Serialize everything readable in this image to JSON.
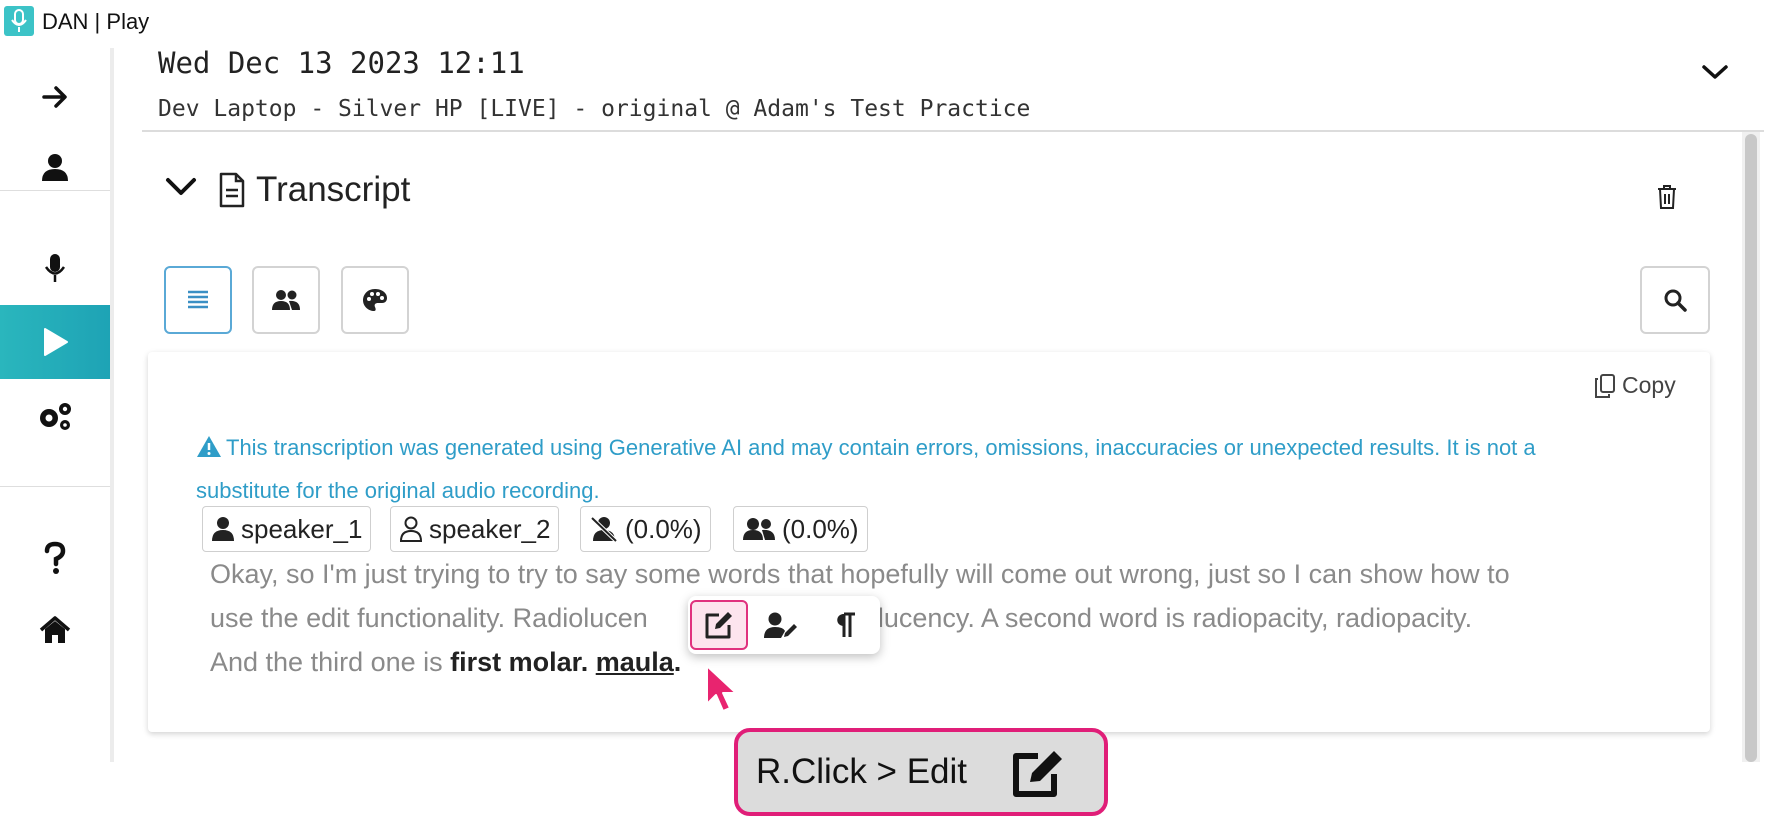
{
  "window": {
    "title": "DAN | Play"
  },
  "sidebar": {
    "items": [
      {
        "icon": "arrow-right-icon"
      },
      {
        "icon": "user-icon"
      },
      {
        "icon": "microphone-icon"
      },
      {
        "icon": "play-icon",
        "active": true
      },
      {
        "icon": "gears-icon"
      },
      {
        "icon": "question-icon"
      },
      {
        "icon": "home-icon"
      }
    ]
  },
  "header": {
    "date": "Wed Dec 13 2023 12:11",
    "subtitle": "Dev Laptop - Silver HP [LIVE] - original @ Adam's Test Practice"
  },
  "transcript": {
    "title": "Transcript",
    "copy_label": "Copy",
    "warning": "This transcription was generated using Generative AI and may contain errors, omissions, inaccuracies or unexpected results. It is not a substitute for the original audio recording.",
    "chips": [
      {
        "icon": "user-solid-icon",
        "label": "speaker_1"
      },
      {
        "icon": "user-outline-icon",
        "label": "speaker_2"
      },
      {
        "icon": "user-slash-icon",
        "label": "(0.0%)"
      },
      {
        "icon": "users-icon",
        "label": "(0.0%)"
      }
    ],
    "text": {
      "line1": "Okay, so I'm just trying to try to say some words that hopefully will come out wrong, just so I can show how to",
      "line2_a": "use the edit functionality. Radiolucen",
      "line2_b": "radiolucency. A second word is radiopacity, radiopacity.",
      "line3_a": "And the third one is ",
      "line3_bold": "first molar.",
      "line3_underlined": "maula",
      "line3_end": "."
    }
  },
  "context_menu": {
    "items": [
      {
        "icon": "edit-icon",
        "highlighted": true
      },
      {
        "icon": "user-edit-icon"
      },
      {
        "icon": "paragraph-icon"
      }
    ]
  },
  "callout": {
    "text": "R.Click > Edit",
    "icon": "edit-icon"
  },
  "colors": {
    "accent": "#2ab6bd",
    "callout_border": "#e01e78",
    "warning": "#2f9dc8"
  }
}
